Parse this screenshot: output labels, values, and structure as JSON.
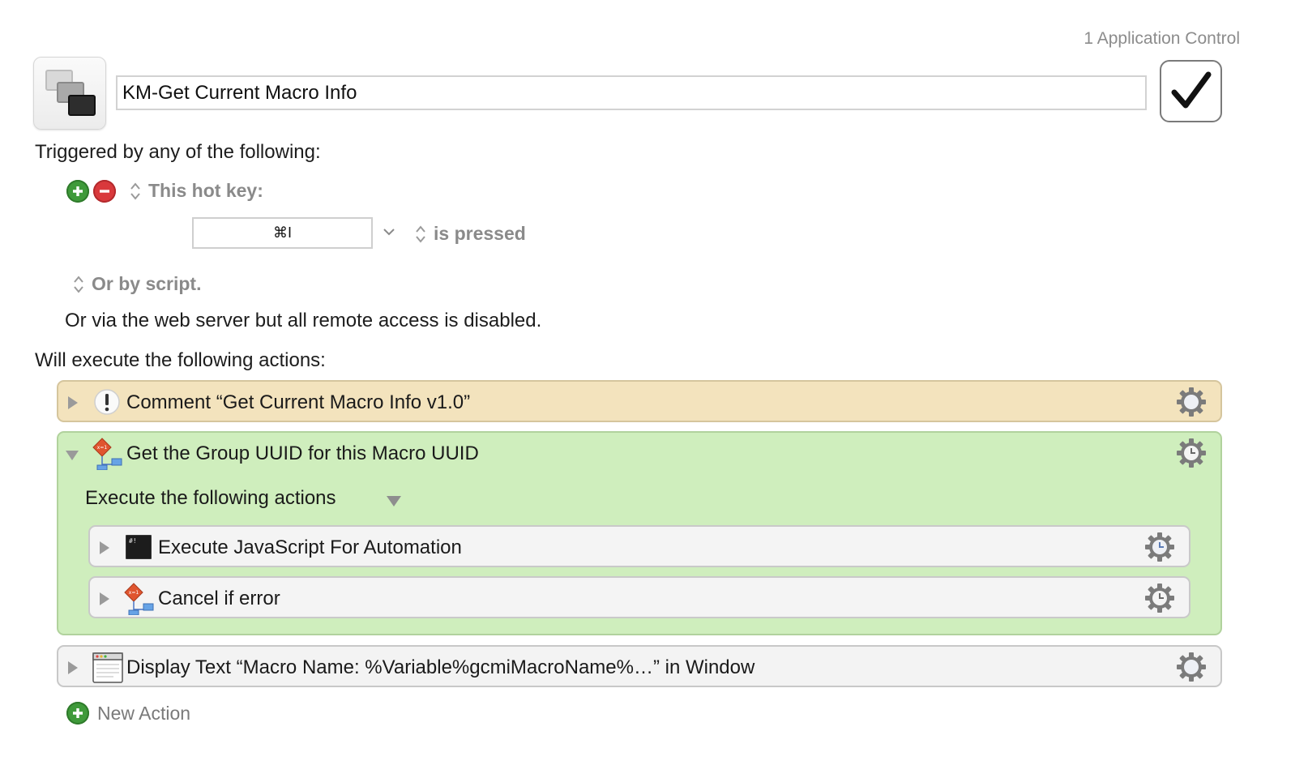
{
  "header": {
    "group_label": "1 Application Control",
    "macro_name": "KM-Get Current Macro Info",
    "enabled": true
  },
  "triggers": {
    "heading": "Triggered by any of the following:",
    "hotkey_label": "This hot key:",
    "hotkey_value": "⌘I",
    "hotkey_state": "is pressed",
    "script_label": "Or by script.",
    "web_server_note": "Or via the web server but all remote access is disabled."
  },
  "actions": {
    "heading": "Will execute the following actions:",
    "comment_title": "Comment “Get Current Macro Info v1.0”",
    "group_title": "Get the Group UUID for this Macro UUID",
    "group_subheading": "Execute the following actions",
    "inner_items": [
      "Execute JavaScript For Automation",
      "Cancel if error"
    ],
    "display_title": "Display Text “Macro Name: %Variable%gcmiMacroName%…” in Window",
    "new_action_label": "New Action"
  },
  "colors": {
    "comment_bg": "#f3e3bd",
    "group_bg": "#cfeebd",
    "plus_green": "#3f9a3a",
    "minus_red": "#d9393c"
  },
  "icons": [
    "macro-group-icon",
    "checkmark-icon",
    "add-icon",
    "remove-icon",
    "updown-arrows-icon",
    "chevron-down-icon",
    "disclosure-triangle-icon",
    "exclamation-icon",
    "if-then-flowchart-icon",
    "terminal-icon",
    "window-icon",
    "gear-icon",
    "gear-clock-icon"
  ]
}
